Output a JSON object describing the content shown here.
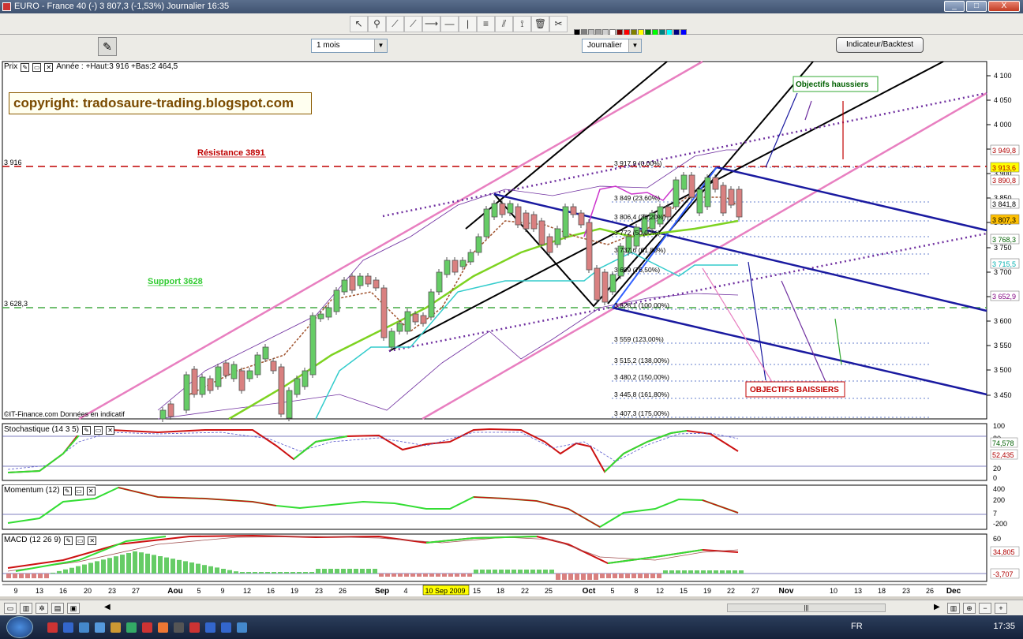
{
  "window": {
    "title": "EURO - France 40 (-)    3 807,3 (-1,53%)    Journalier  16:35",
    "btn_min": "_",
    "btn_max": "□",
    "btn_close": "X"
  },
  "toolbar": {
    "icons": [
      "cursor-icon",
      "zoom-icon",
      "line-icon",
      "trend-line-icon",
      "ray-icon",
      "hline-icon",
      "vline-icon",
      "fibonacci-icon",
      "channel-icon",
      "pitchfork-icon",
      "delete-icon",
      "tools-icon"
    ],
    "palette": [
      "#000000",
      "#808080",
      "#c0c0c0",
      "#a0a0a0",
      "#d0d0d0",
      "#ffffff",
      "#800000",
      "#ff0000",
      "#808000",
      "#ffff00",
      "#008000",
      "#00ff00",
      "#008080",
      "#00ffff",
      "#000080",
      "#0000ff",
      "#800080",
      "#ff00ff",
      "#808040",
      "#ffff80",
      "#004040",
      "#00ff80",
      "#0080ff",
      "#8080ff",
      "#400080",
      "#ff0080",
      "#804000",
      "#ff8040",
      "#ffffff",
      "#e0e0e0",
      "#f0f0f0",
      "#fafafa"
    ]
  },
  "controls": {
    "period": "1 mois",
    "interval": "Journalier",
    "indicator_button": "Indicateur/Backtest"
  },
  "price_panel": {
    "label": "Prix",
    "info": "Année : +Haut:3 916 +Bas:2 464,5",
    "copyright": "copyright: tradosaure-trading.blogspot.com",
    "resistance_label": "Résistance 3891",
    "support_label": "Support 3628",
    "left_level_top": "3 916",
    "left_level_bottom": "3 628,3",
    "objectifs_haussiers": "Objectifs haussiers",
    "objectifs_baissiers": "OBJECTIFS BAISSIERS",
    "source": "©IT-Finance.com  Données en indicatif",
    "fib_levels": [
      {
        "label": "3 917,9 (0,00%)",
        "row": 212
      },
      {
        "label": "3 849 (23,60%)",
        "row": 256
      },
      {
        "label": "3 806,4 (38,20%)",
        "row": 280
      },
      {
        "label": "3 772 (50,00%)",
        "row": 300
      },
      {
        "label": "3 737,6 (61,80%)",
        "row": 322
      },
      {
        "label": "3 699 (76,50%)",
        "row": 347
      },
      {
        "label": "3 628,1 (100,00%)",
        "row": 392
      },
      {
        "label": "3 559 (123,00%)",
        "row": 435
      },
      {
        "label": "3 515,2 (138,00%)",
        "row": 462
      },
      {
        "label": "3 480,2 (150,00%)",
        "row": 483
      },
      {
        "label": "3 445,8 (161,80%)",
        "row": 505
      },
      {
        "label": "3 407,3 (175,00%)",
        "row": 529
      }
    ],
    "axis_ticks": [
      "4 100",
      "4 050",
      "4 000",
      "3 950",
      "3 900",
      "3 850",
      "3 800",
      "3 750",
      "3 700",
      "3 650",
      "3 600",
      "3 550",
      "3 500",
      "3 450"
    ],
    "right_badges": [
      {
        "text": "3 949,8",
        "bg": "#ffffff",
        "fg": "#b00000"
      },
      {
        "text": "3 913,6",
        "bg": "#ffff00",
        "fg": "#b00000"
      },
      {
        "text": "3 890,8",
        "bg": "#ffffff",
        "fg": "#b00000"
      },
      {
        "text": "3 841,8",
        "bg": "#ffffff",
        "fg": "#000000"
      },
      {
        "text": "3 807,3",
        "bg": "#ffc000",
        "fg": "#000000"
      },
      {
        "text": "3 768,3",
        "bg": "#ffffff",
        "fg": "#006000"
      },
      {
        "text": "3 715,5",
        "bg": "#ffffff",
        "fg": "#00b0b0"
      },
      {
        "text": "3 652,9",
        "bg": "#ffffff",
        "fg": "#800080"
      }
    ]
  },
  "stochastique": {
    "label": "Stochastique (14 3 5)",
    "ticks": [
      "100",
      "80",
      "20",
      "0"
    ],
    "badges": [
      "74,578",
      "52,435"
    ]
  },
  "momentum": {
    "label": "Momentum (12)",
    "ticks": [
      "400",
      "200",
      "7",
      "-200"
    ]
  },
  "macd": {
    "label": "MACD (12 26 9)",
    "ticks": [
      "60",
      "34,805",
      "-3,707"
    ]
  },
  "x_axis": {
    "labels": [
      "9",
      "13",
      "16",
      "20",
      "23",
      "27",
      "Aou",
      "5",
      "9",
      "12",
      "16",
      "19",
      "23",
      "26",
      "Sep",
      "4",
      "10 Sep 2009",
      "15",
      "18",
      "22",
      "25",
      "Oct",
      "5",
      "8",
      "12",
      "15",
      "19",
      "22",
      "27",
      "Nov",
      "10",
      "13",
      "18",
      "23",
      "26",
      "Dec"
    ]
  },
  "taskbar": {
    "lang": "FR",
    "time": "17:35"
  }
}
